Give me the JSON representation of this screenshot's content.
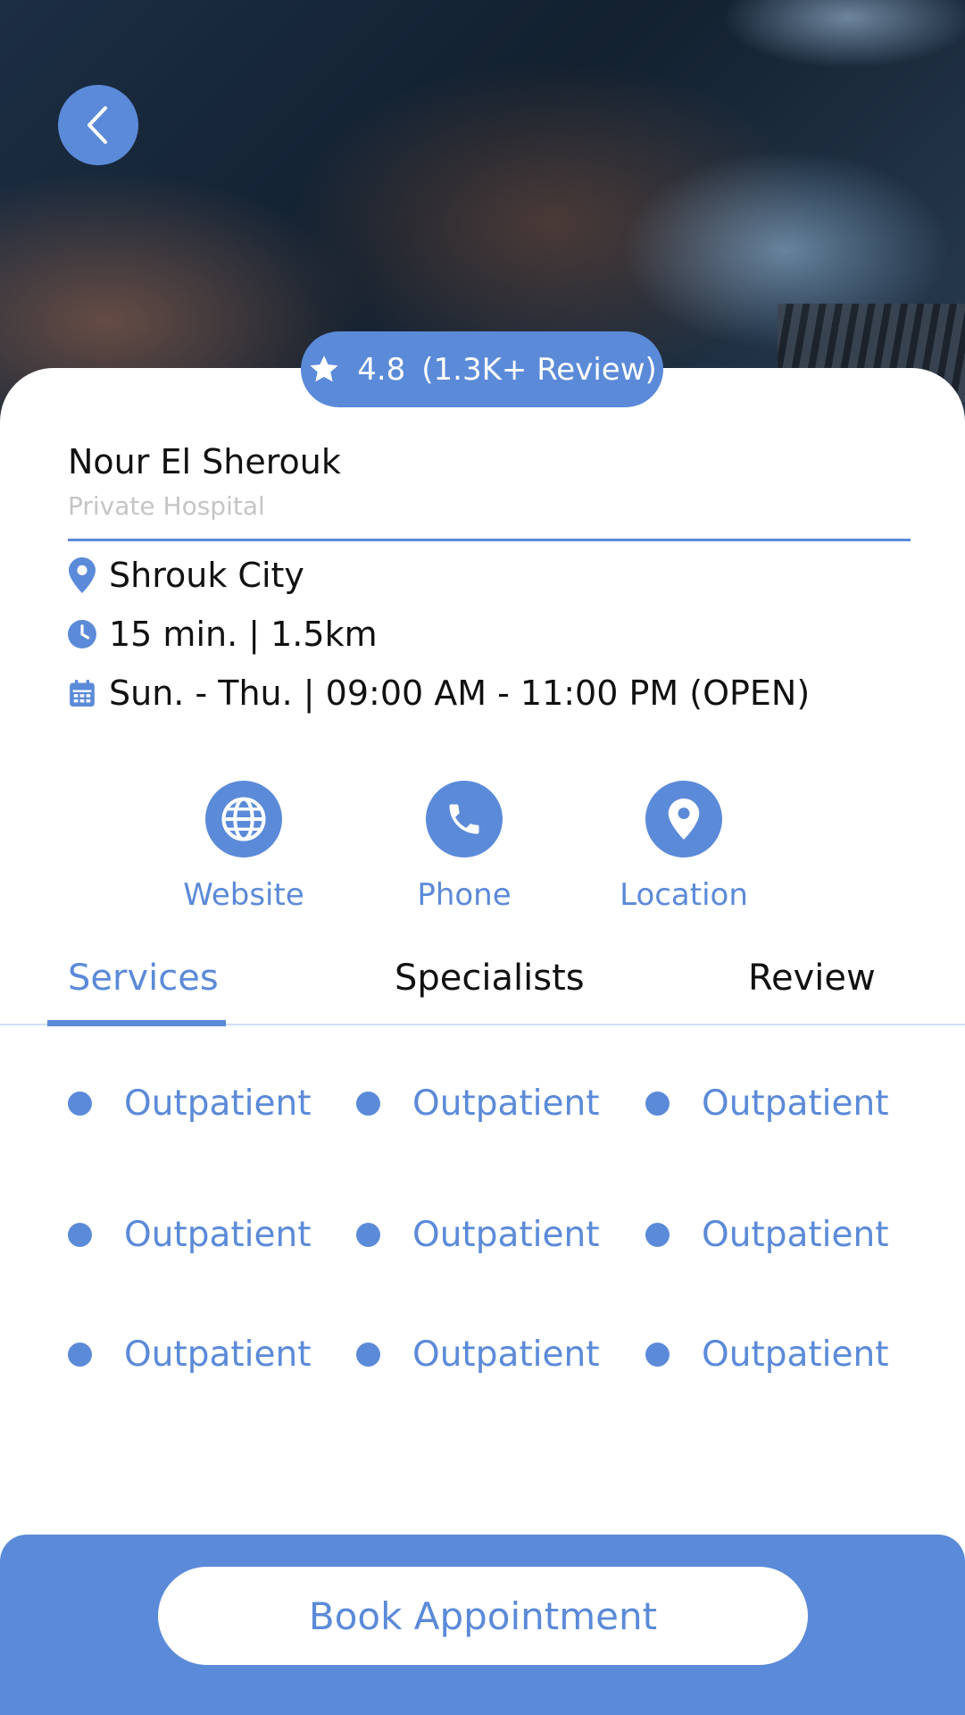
{
  "rating": {
    "score": "4.8",
    "count_text": "(1.3K+ Review)"
  },
  "facility": {
    "name": "Nour El Sherouk",
    "type": "Private Hospital"
  },
  "info": {
    "location": "Shrouk City",
    "distance": "15 min. | 1.5km",
    "hours": "Sun. - Thu. | 09:00 AM - 11:00 PM (OPEN)"
  },
  "actions": {
    "website": "Website",
    "phone": "Phone",
    "location": "Location"
  },
  "tabs": {
    "services": "Services",
    "specialists": "Specialists",
    "review": "Review",
    "active": "Services"
  },
  "services": [
    "Outpatient",
    "Outpatient",
    "Outpatient",
    "Outpatient",
    "Outpatient",
    "Outpatient",
    "Outpatient",
    "Outpatient",
    "Outpatient"
  ],
  "cta": {
    "book_label": "Book Appointment"
  },
  "colors": {
    "accent": "#5b8ad8",
    "text": "#111111",
    "muted": "#c5c5c5"
  }
}
